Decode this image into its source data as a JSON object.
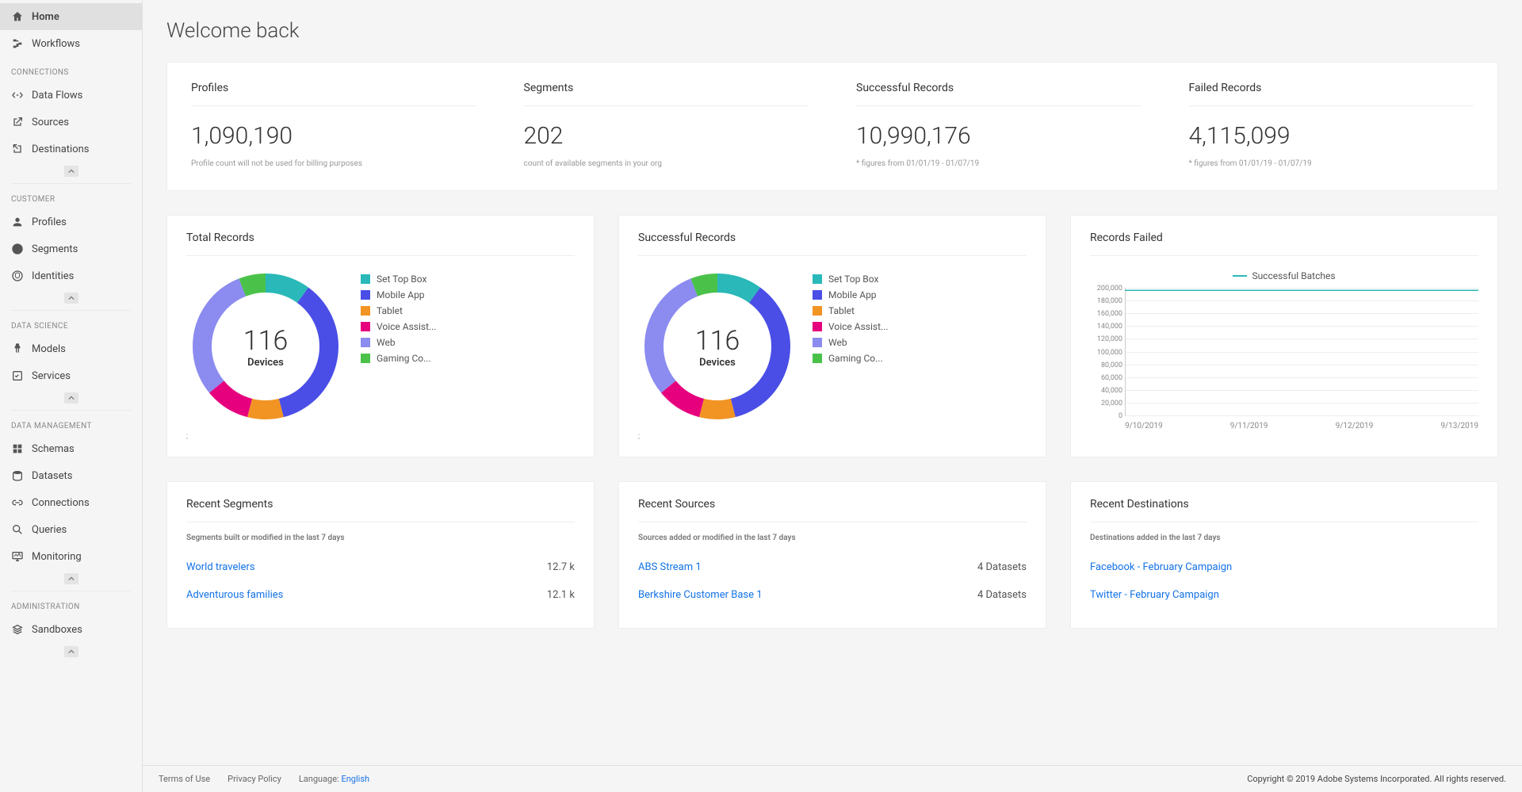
{
  "sidebar": {
    "top": [
      {
        "label": "Home",
        "icon": "home",
        "active": true
      },
      {
        "label": "Workflows",
        "icon": "workflow"
      }
    ],
    "groups": [
      {
        "header": "CONNECTIONS",
        "items": [
          {
            "label": "Data Flows",
            "icon": "dataflow"
          },
          {
            "label": "Sources",
            "icon": "source"
          },
          {
            "label": "Destinations",
            "icon": "destination"
          }
        ]
      },
      {
        "header": "CUSTOMER",
        "items": [
          {
            "label": "Profiles",
            "icon": "profile"
          },
          {
            "label": "Segments",
            "icon": "segment"
          },
          {
            "label": "Identities",
            "icon": "identity"
          }
        ]
      },
      {
        "header": "DATA SCIENCE",
        "items": [
          {
            "label": "Models",
            "icon": "model"
          },
          {
            "label": "Services",
            "icon": "service"
          }
        ]
      },
      {
        "header": "DATA MANAGEMENT",
        "items": [
          {
            "label": "Schemas",
            "icon": "schema"
          },
          {
            "label": "Datasets",
            "icon": "dataset"
          },
          {
            "label": "Connections",
            "icon": "connection"
          },
          {
            "label": "Queries",
            "icon": "query"
          },
          {
            "label": "Monitoring",
            "icon": "monitor"
          }
        ]
      },
      {
        "header": "ADMINISTRATION",
        "items": [
          {
            "label": "Sandboxes",
            "icon": "sandbox"
          }
        ]
      }
    ]
  },
  "page": {
    "title": "Welcome back"
  },
  "summary": [
    {
      "title": "Profiles",
      "value": "1,090,190",
      "sub": "Profile count will not be used for billing purposes"
    },
    {
      "title": "Segments",
      "value": "202",
      "sub": "count of available segments in your org"
    },
    {
      "title": "Successful Records",
      "value": "10,990,176",
      "sub": "* figures from 01/01/19 - 01/07/19"
    },
    {
      "title": "Failed Records",
      "value": "4,115,099",
      "sub": "* figures from 01/01/19 - 01/07/19"
    }
  ],
  "donuts": [
    {
      "title": "Total Records",
      "center_value": "116",
      "center_label": "Devices",
      "note": ";"
    },
    {
      "title": "Successful Records",
      "center_value": "116",
      "center_label": "Devices",
      "note": ";"
    }
  ],
  "donut_legend": [
    {
      "label": "Set Top Box",
      "color": "#2ab8b8"
    },
    {
      "label": "Mobile App",
      "color": "#4a4ee6"
    },
    {
      "label": "Tablet",
      "color": "#f29423"
    },
    {
      "label": "Voice Assist...",
      "color": "#e6007e"
    },
    {
      "label": "Web",
      "color": "#8b8bf0"
    },
    {
      "label": "Gaming Co...",
      "color": "#4ac24a"
    }
  ],
  "records_failed": {
    "title": "Records Failed",
    "legend": "Successful Batches",
    "yTicks": [
      "200,000",
      "180,000",
      "160,000",
      "140,000",
      "120,000",
      "100,000",
      "80,000",
      "60,000",
      "40,000",
      "20,000",
      "0"
    ],
    "xTicks": [
      "9/10/2019",
      "9/11/2019",
      "9/12/2019",
      "9/13/2019"
    ]
  },
  "recent_segments": {
    "title": "Recent Segments",
    "subtitle": "Segments built or modified in the last 7 days",
    "items": [
      {
        "name": "World travelers",
        "meta": "12.7 k"
      },
      {
        "name": "Adventurous families",
        "meta": "12.1 k"
      }
    ]
  },
  "recent_sources": {
    "title": "Recent Sources",
    "subtitle": "Sources added or modified in the last 7 days",
    "items": [
      {
        "name": "ABS Stream 1",
        "meta": "4 Datasets"
      },
      {
        "name": "Berkshire Customer Base 1",
        "meta": "4 Datasets"
      }
    ]
  },
  "recent_destinations": {
    "title": "Recent Destinations",
    "subtitle": "Destinations added in the last 7 days",
    "items": [
      {
        "name": "Facebook - February Campaign",
        "meta": ""
      },
      {
        "name": "Twitter - February Campaign",
        "meta": ""
      }
    ]
  },
  "footer": {
    "terms": "Terms of Use",
    "privacy": "Privacy Policy",
    "lang_label": "Language:",
    "lang_value": "English",
    "copyright": "Copyright  ©  2019 Adobe Systems Incorporated.  All rights reserved."
  },
  "chart_data": [
    {
      "type": "pie",
      "title": "Total Records — 116 Devices",
      "series": [
        {
          "name": "Devices",
          "values": [
            10,
            36,
            8,
            10,
            30,
            6
          ]
        }
      ],
      "categories": [
        "Set Top Box",
        "Mobile App",
        "Tablet",
        "Voice Assistant",
        "Web",
        "Gaming Console"
      ],
      "colors": [
        "#2ab8b8",
        "#4a4ee6",
        "#f29423",
        "#e6007e",
        "#8b8bf0",
        "#4ac24a"
      ]
    },
    {
      "type": "pie",
      "title": "Successful Records — 116 Devices",
      "series": [
        {
          "name": "Devices",
          "values": [
            10,
            36,
            8,
            10,
            30,
            6
          ]
        }
      ],
      "categories": [
        "Set Top Box",
        "Mobile App",
        "Tablet",
        "Voice Assistant",
        "Web",
        "Gaming Console"
      ],
      "colors": [
        "#2ab8b8",
        "#4a4ee6",
        "#f29423",
        "#e6007e",
        "#8b8bf0",
        "#4ac24a"
      ]
    },
    {
      "type": "line",
      "title": "Records Failed",
      "x": [
        "9/10/2019",
        "9/11/2019",
        "9/12/2019",
        "9/13/2019"
      ],
      "series": [
        {
          "name": "Successful Batches",
          "values": [
            200000,
            200000,
            200000,
            200000
          ]
        }
      ],
      "ylim": [
        0,
        200000
      ],
      "ylabel": "",
      "xlabel": ""
    }
  ]
}
